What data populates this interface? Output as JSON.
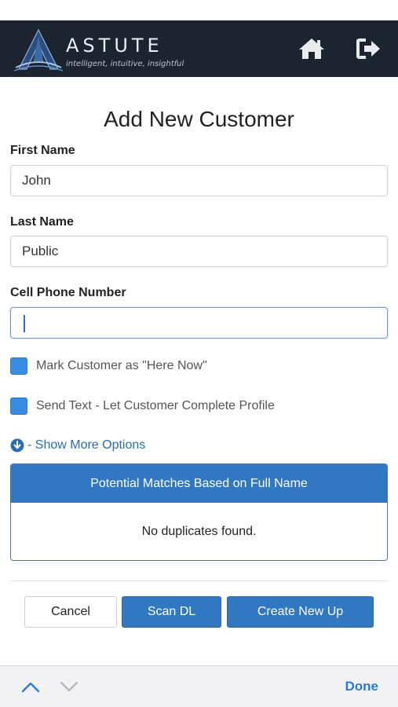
{
  "header": {
    "brand_name": "ASTUTE",
    "tagline": "intelligent, intuitive, insightful",
    "home_icon": "home-icon",
    "logout_icon": "sign-out-icon"
  },
  "form": {
    "title": "Add New Customer",
    "first_name": {
      "label": "First Name",
      "value": "John"
    },
    "last_name": {
      "label": "Last Name",
      "value": "Public"
    },
    "cell_phone": {
      "label": "Cell Phone Number",
      "value": ""
    },
    "here_now": {
      "label": "Mark Customer as \"Here Now\""
    },
    "send_text": {
      "label": "Send Text - Let Customer Complete Profile"
    },
    "more_options": {
      "label": "- Show More Options",
      "icon": "arrow-circle-down-icon"
    }
  },
  "matches": {
    "header": "Potential Matches Based on Full Name",
    "message": "No duplicates found."
  },
  "buttons": {
    "cancel": "Cancel",
    "scan_dl": "Scan DL",
    "create_new_up": "Create New Up"
  },
  "keyboard_toolbar": {
    "done": "Done",
    "prev_icon": "chevron-up-icon",
    "next_icon": "chevron-down-icon"
  },
  "colors": {
    "header_bg": "#1c2430",
    "accent": "#3277c2",
    "link": "#2a6db5",
    "checkbox": "#3a8be6",
    "done": "#2b7bd6"
  }
}
